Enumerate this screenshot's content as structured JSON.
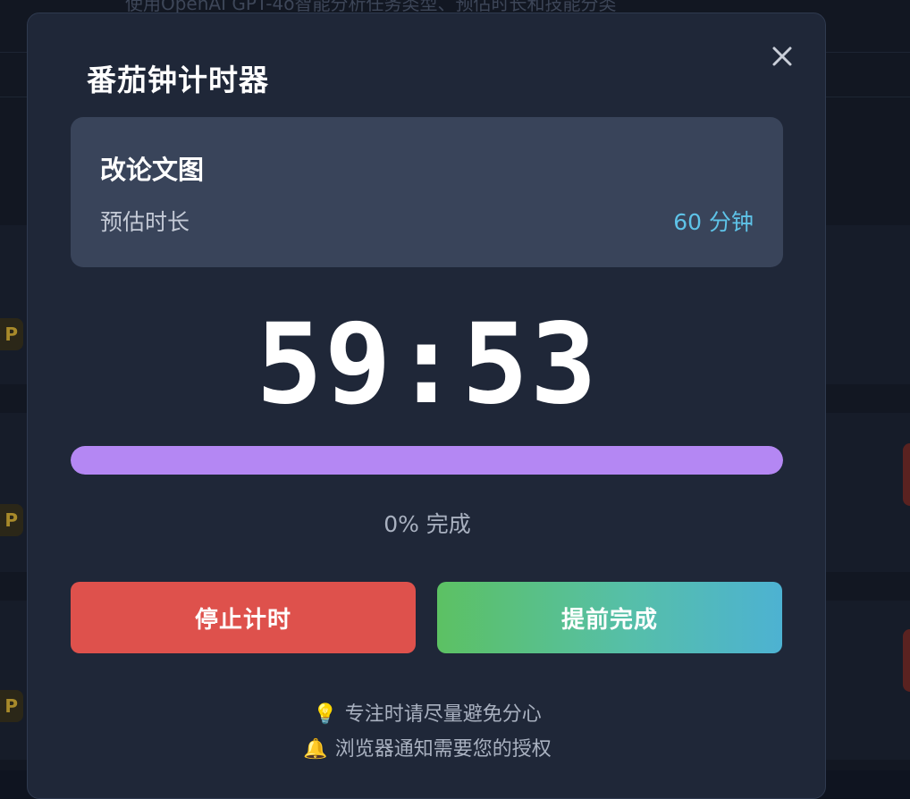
{
  "background": {
    "top_text": "使用OpenAI GPT-4o智能分析任务类型、预估时长和技能分类",
    "badge_letter": "P"
  },
  "modal": {
    "title": "番茄钟计时器",
    "close_icon": "close-icon"
  },
  "task": {
    "name": "改论文图",
    "estimate_label": "预估时长",
    "estimate_value": "60 分钟"
  },
  "timer": {
    "display": "59:53"
  },
  "progress": {
    "percent": 0,
    "text": "0% 完成",
    "fill_color": "#b487f3"
  },
  "buttons": {
    "stop_label": "停止计时",
    "complete_label": "提前完成"
  },
  "tips": [
    {
      "icon": "💡",
      "icon_name": "lightbulb-icon",
      "text": "专注时请尽量避免分心"
    },
    {
      "icon": "🔔",
      "icon_name": "bell-icon",
      "text": "浏览器通知需要您的授权"
    }
  ],
  "colors": {
    "stop_button": "#de514c",
    "complete_gradient": [
      "#5cc163",
      "#4db2d2"
    ],
    "accent": "#5ec3e8"
  }
}
